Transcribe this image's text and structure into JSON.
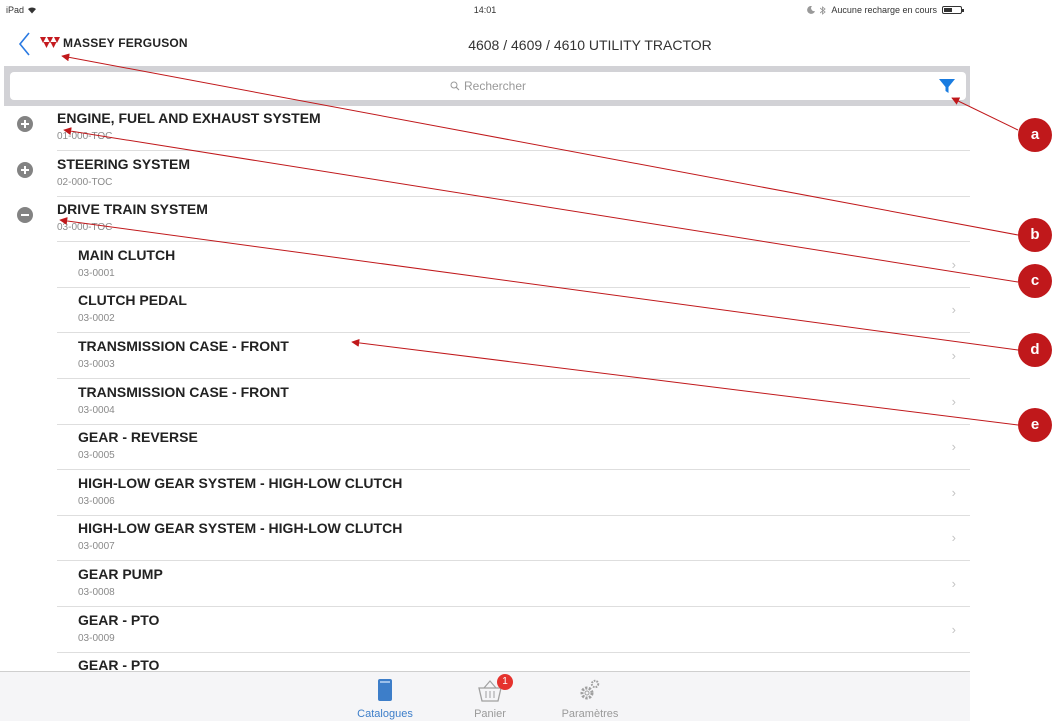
{
  "status_bar": {
    "device": "iPad",
    "time": "14:01",
    "battery_text": "Aucune recharge en cours",
    "battery_level": 0.5
  },
  "nav": {
    "back_icon": "chevron-left-icon",
    "brand": "MASSEY FERGUSON",
    "title": "4608 / 4609 / 4610 UTILITY TRACTOR"
  },
  "search": {
    "placeholder": "Rechercher",
    "filter_icon": "filter-icon"
  },
  "accent_color": "#1a7ce0",
  "brand_color": "#c41a1f",
  "sections": [
    {
      "title": "ENGINE, FUEL AND EXHAUST SYSTEM",
      "code": "01-000-TOC",
      "expanded": false
    },
    {
      "title": "STEERING SYSTEM",
      "code": "02-000-TOC",
      "expanded": false
    },
    {
      "title": "DRIVE TRAIN SYSTEM",
      "code": "03-000-TOC",
      "expanded": true
    }
  ],
  "items": [
    {
      "title": "MAIN CLUTCH",
      "code": "03-0001"
    },
    {
      "title": "CLUTCH PEDAL",
      "code": "03-0002"
    },
    {
      "title": "TRANSMISSION CASE - FRONT",
      "code": "03-0003"
    },
    {
      "title": "TRANSMISSION CASE - FRONT",
      "code": "03-0004"
    },
    {
      "title": "GEAR - REVERSE",
      "code": "03-0005"
    },
    {
      "title": "HIGH-LOW GEAR SYSTEM - HIGH-LOW CLUTCH",
      "code": "03-0006"
    },
    {
      "title": "HIGH-LOW GEAR SYSTEM - HIGH-LOW CLUTCH",
      "code": "03-0007"
    },
    {
      "title": "GEAR PUMP",
      "code": "03-0008"
    },
    {
      "title": "GEAR - PTO",
      "code": "03-0009"
    },
    {
      "title": "GEAR - PTO",
      "code": ""
    }
  ],
  "tabs": [
    {
      "label": "Catalogues",
      "icon": "book-icon",
      "active": true
    },
    {
      "label": "Panier",
      "icon": "basket-icon",
      "badge": "1"
    },
    {
      "label": "Paramètres",
      "icon": "gears-icon"
    }
  ],
  "callouts": [
    "a",
    "b",
    "c",
    "d",
    "e"
  ]
}
